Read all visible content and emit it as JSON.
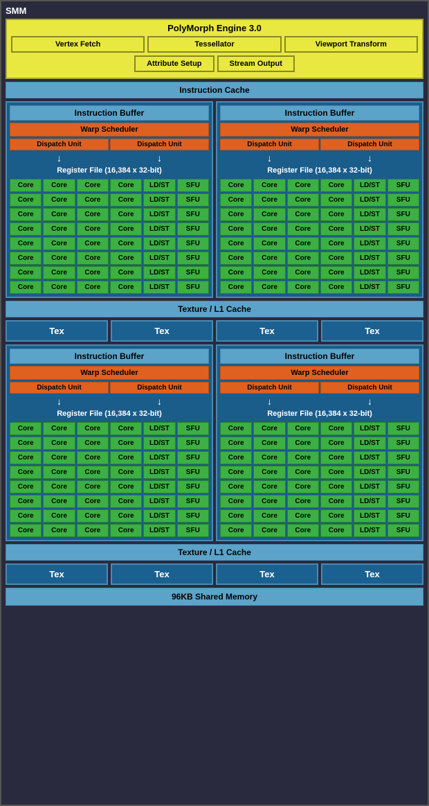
{
  "title": "SMM",
  "polymorph": {
    "title": "PolyMorph Engine 3.0",
    "row1": [
      "Vertex Fetch",
      "Tessellator",
      "Viewport Transform"
    ],
    "row2": [
      "Attribute Setup",
      "Stream Output"
    ]
  },
  "instruction_cache": "Instruction Cache",
  "instruction_buffer": "Instruction Buffer",
  "warp_scheduler": "Warp Scheduler",
  "dispatch_unit": "Dispatch Unit",
  "register_file": "Register File (16,384 x 32-bit)",
  "texture_l1": "Texture / L1 Cache",
  "tex": "Tex",
  "shared_memory": "96KB Shared Memory",
  "core_label": "Core",
  "ldst_label": "LD/ST",
  "sfu_label": "SFU",
  "rows_count": 8
}
